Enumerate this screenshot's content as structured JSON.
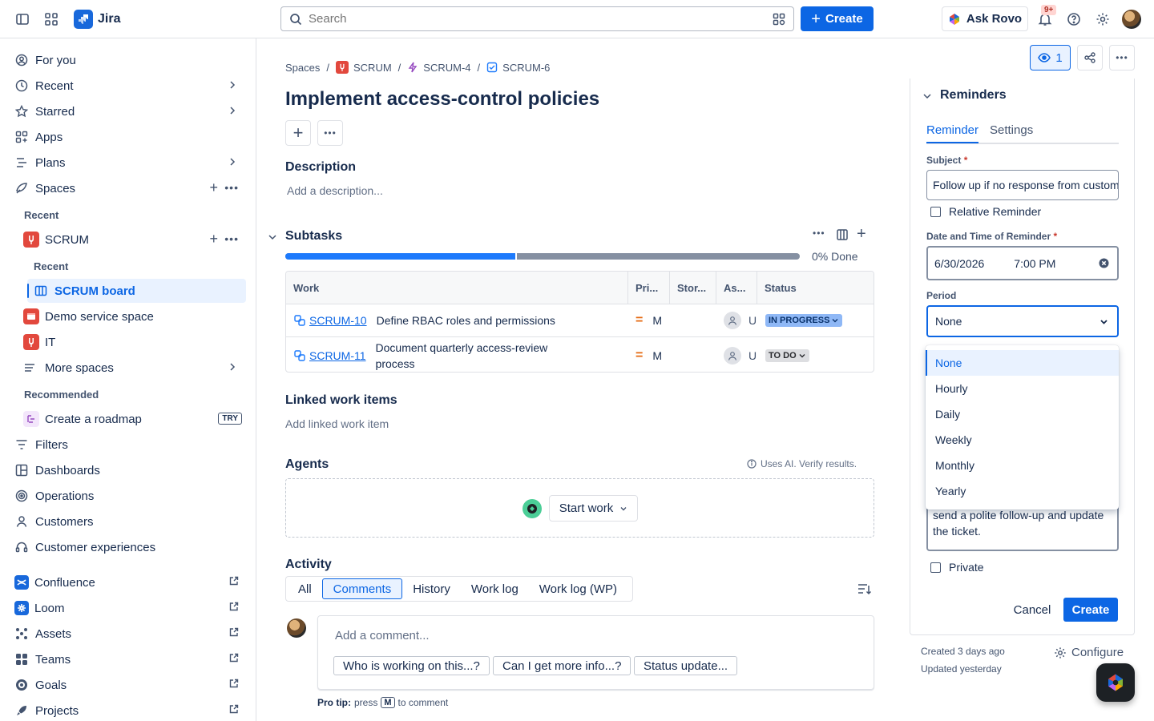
{
  "topbar": {
    "app_name": "Jira",
    "search_placeholder": "Search",
    "create_label": "Create",
    "ask_rovo_label": "Ask Rovo",
    "notifications_badge": "9+"
  },
  "sidebar": {
    "top_items": [
      {
        "label": "For you",
        "icon": "user-circle-icon"
      },
      {
        "label": "Recent",
        "icon": "clock-icon"
      },
      {
        "label": "Starred",
        "icon": "star-icon"
      },
      {
        "label": "Apps",
        "icon": "apps-icon"
      },
      {
        "label": "Plans",
        "icon": "plans-icon"
      },
      {
        "label": "Spaces",
        "icon": "spaces-icon"
      }
    ],
    "recent_heading": "Recent",
    "scrum_space": "SCRUM",
    "scrum_recent_heading": "Recent",
    "scrum_board": "SCRUM board",
    "demo_space": "Demo service space",
    "it_space": "IT",
    "more_spaces": "More spaces",
    "recommended_heading": "Recommended",
    "create_roadmap": "Create a roadmap",
    "try_badge": "TRY",
    "lower_items": [
      {
        "label": "Filters",
        "icon": "filter-icon"
      },
      {
        "label": "Dashboards",
        "icon": "dashboard-icon"
      },
      {
        "label": "Operations",
        "icon": "operations-icon"
      },
      {
        "label": "Customers",
        "icon": "customers-icon"
      },
      {
        "label": "Customer experiences",
        "icon": "headset-icon"
      }
    ],
    "apps": [
      {
        "label": "Confluence",
        "color": "#1868db"
      },
      {
        "label": "Loom",
        "color": "#1868db"
      },
      {
        "label": "Assets",
        "color": "#44546f"
      },
      {
        "label": "Teams",
        "color": "#44546f"
      },
      {
        "label": "Goals",
        "color": "#44546f"
      },
      {
        "label": "Projects",
        "color": "#44546f"
      }
    ]
  },
  "issue": {
    "breadcrumb": [
      "Spaces",
      "SCRUM",
      "SCRUM-4",
      "SCRUM-6"
    ],
    "title": "Implement access-control policies",
    "description_heading": "Description",
    "description_placeholder": "Add a description...",
    "subtasks_heading": "Subtasks",
    "progress_label": "0% Done",
    "progress_fraction": 0.45,
    "columns": [
      "Work",
      "Pri...",
      "Stor...",
      "As...",
      "Status"
    ],
    "subtasks": [
      {
        "key": "SCRUM-10",
        "summary": "Define RBAC roles and permissions",
        "priority": "M",
        "assignee": "U",
        "status": "IN PROGRESS",
        "status_bg": "#8fb8f6",
        "status_color": "#09326c"
      },
      {
        "key": "SCRUM-11",
        "summary": "Document quarterly access-review process",
        "priority": "M",
        "assignee": "U",
        "status": "TO DO",
        "status_bg": "#dddee1",
        "status_color": "#292a2e"
      }
    ],
    "linked_heading": "Linked work items",
    "linked_placeholder": "Add linked work item",
    "agents_heading": "Agents",
    "ai_note": "Uses AI. Verify results.",
    "start_work": "Start work",
    "activity_heading": "Activity",
    "activity_tabs": [
      "All",
      "Comments",
      "History",
      "Work log",
      "Work log (WP)"
    ],
    "comment_placeholder": "Add a comment...",
    "suggestions": [
      "Who is working on this...?",
      "Can I get more info...?",
      "Status update..."
    ],
    "pro_tip_prefix": "Pro tip:",
    "pro_tip_press": "press",
    "pro_tip_key": "M",
    "pro_tip_suffix": "to comment"
  },
  "right": {
    "watch_count": "1",
    "reminders_heading": "Reminders",
    "tabs": [
      "Reminder",
      "Settings"
    ],
    "subject_label": "Subject",
    "subject_value": "Follow up if no response from customer",
    "relative_label": "Relative Reminder",
    "datetime_label": "Date and Time of Reminder",
    "date_value": "6/30/2026",
    "time_value": "7:00 PM",
    "period_label": "Period",
    "period_value": "None",
    "period_options": [
      "None",
      "Hourly",
      "Daily",
      "Weekly",
      "Monthly",
      "Yearly"
    ],
    "message_line1": "send a polite follow-up and update",
    "message_line2": "the ticket.",
    "private_label": "Private",
    "cancel_label": "Cancel",
    "create_label": "Create",
    "created": "Created 3 days ago",
    "updated": "Updated yesterday",
    "configure_label": "Configure"
  }
}
